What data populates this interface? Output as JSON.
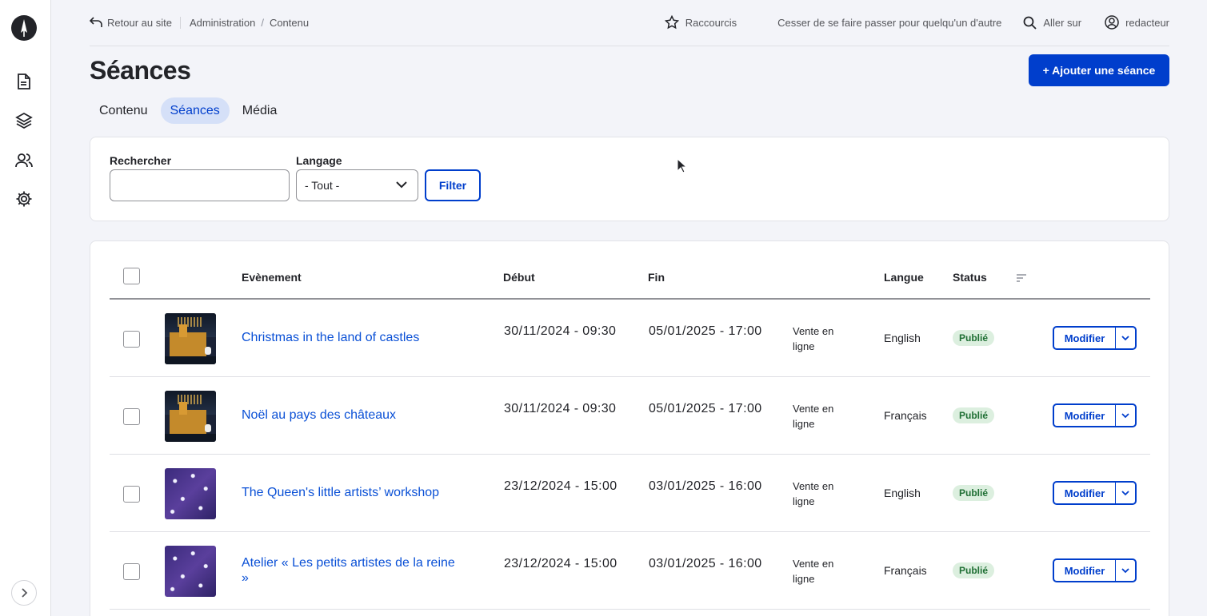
{
  "topbar": {
    "back": "Retour au site",
    "breadcrumb": [
      "Administration",
      "Contenu"
    ],
    "shortcuts": "Raccourcis",
    "stop_impersonate": "Cesser de se faire passer pour quelqu'un d'autre",
    "go_to": "Aller sur",
    "user": "redacteur"
  },
  "page": {
    "title": "Séances",
    "add_button": "+ Ajouter une séance",
    "tabs": [
      "Contenu",
      "Séances",
      "Média"
    ]
  },
  "filter": {
    "search_label": "Rechercher",
    "search_value": "",
    "lang_label": "Langage",
    "lang_value": "- Tout -",
    "button": "Filter"
  },
  "table": {
    "headers": {
      "event": "Evènement",
      "start": "Début",
      "end": "Fin",
      "lang": "Langue",
      "status": "Status"
    },
    "rows": [
      {
        "title": "Christmas in the land of castles",
        "start": "30/11/2024 - 09:30",
        "end": "05/01/2025 - 17:00",
        "sale": "Vente en ligne",
        "lang": "English",
        "status": "Publié",
        "action": "Modifier",
        "thumb": "castle"
      },
      {
        "title": "Noël au pays des châteaux",
        "start": "30/11/2024 - 09:30",
        "end": "05/01/2025 - 17:00",
        "sale": "Vente en ligne",
        "lang": "Français",
        "status": "Publié",
        "action": "Modifier",
        "thumb": "castle"
      },
      {
        "title": "The Queen's little artists’ workshop",
        "start": "23/12/2024 - 15:00",
        "end": "03/01/2025 - 16:00",
        "sale": "Vente en ligne",
        "lang": "English",
        "status": "Publié",
        "action": "Modifier",
        "thumb": "stars"
      },
      {
        "title": "Atelier « Les petits artistes de la reine »",
        "start": "23/12/2024 - 15:00",
        "end": "03/01/2025 - 16:00",
        "sale": "Vente en ligne",
        "lang": "Français",
        "status": "Publié",
        "action": "Modifier",
        "thumb": "stars"
      }
    ]
  },
  "colors": {
    "primary": "#003ecc",
    "link": "#0a50d6",
    "badge_bg": "#dcefdf",
    "badge_text": "#1f6f34"
  }
}
